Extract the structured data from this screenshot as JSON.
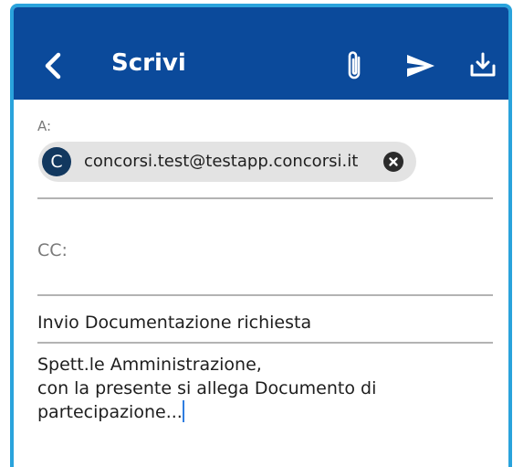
{
  "app": {
    "title": "Scrivi",
    "accent_color": "#0b4a9b",
    "frame_color": "#2aa3dc"
  },
  "toolbar": {
    "back_icon": "chevron-left-icon",
    "attach_icon": "paperclip-icon",
    "send_icon": "send-icon",
    "save_icon": "download-icon"
  },
  "compose": {
    "to_label": "A:",
    "recipients": [
      {
        "initial": "C",
        "email": "concorsi.test@testapp.concorsi.it",
        "remove_icon": "close-circle-icon"
      }
    ],
    "cc_label": "CC:",
    "subject": "Invio Documentazione richiesta",
    "body": "Spett.le Amministrazione,\ncon la presente si allega Documento di\npartecipazione..."
  }
}
